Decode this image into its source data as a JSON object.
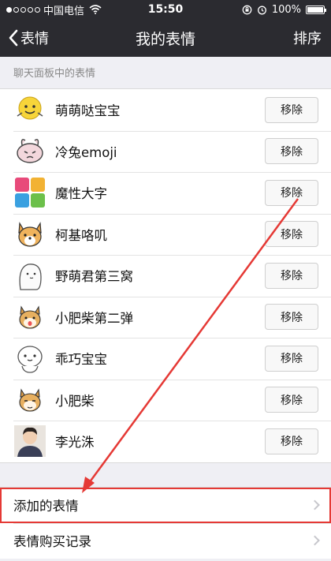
{
  "status_bar": {
    "carrier": "中国电信",
    "time": "15:50",
    "battery": "100%",
    "battery_level": 1.0
  },
  "nav": {
    "back_label": "表情",
    "title": "我的表情",
    "sort_label": "排序"
  },
  "section_label": "聊天面板中的表情",
  "remove_label": "移除",
  "emoji_packs": [
    {
      "name": "萌萌哒宝宝",
      "icon": "smiley-face-icon"
    },
    {
      "name": "冷兔emoji",
      "icon": "rabbit-icon"
    },
    {
      "name": "魔性大字",
      "icon": "text-sticker-icon"
    },
    {
      "name": "柯基咯叽",
      "icon": "corgi-icon"
    },
    {
      "name": "野萌君第三窝",
      "icon": "cat-sticker-icon"
    },
    {
      "name": "小肥柴第二弹",
      "icon": "shiba-icon"
    },
    {
      "name": "乖巧宝宝",
      "icon": "round-baby-icon"
    },
    {
      "name": "小肥柴",
      "icon": "shiba-icon"
    },
    {
      "name": "李光洙",
      "icon": "person-photo-icon"
    }
  ],
  "bottom_rows": [
    {
      "label": "添加的表情"
    },
    {
      "label": "表情购买记录"
    }
  ],
  "colors": {
    "nav_background": "#2b2b30",
    "highlight": "#e53935",
    "page_background": "#efeff4"
  }
}
